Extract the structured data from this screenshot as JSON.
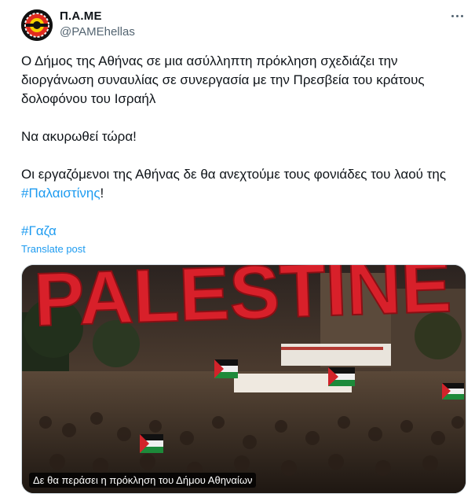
{
  "author": {
    "display_name": "Π.Α.ΜΕ",
    "handle": "@PAMEhellas"
  },
  "tweet": {
    "paragraph1": "Ο Δήμος της Αθήνας σε μια ασύλληπτη πρόκληση σχεδιάζει την διοργάνωση συναυλίας σε συνεργασία με την Πρεσβεία του κράτους δολοφόνου του Ισραήλ",
    "paragraph2": "Να ακυρωθεί τώρα!",
    "paragraph3_text": "Οι εργαζόμενοι της Αθήνας δε θα ανεχτούμε τους φονιάδες του λαού της ",
    "paragraph3_hashtag": "#Παλαιστίνης",
    "paragraph3_end": "!",
    "hashtag_gaza": "#Γαζα",
    "translate_label": "Translate post"
  },
  "media": {
    "banner_text": "PALESTINE",
    "caption": "Δε θα περάσει η πρόκληση του Δήμου Αθηναίων"
  },
  "icons": {
    "more": "more-horizontal-icon",
    "avatar": "pame-logo"
  },
  "colors": {
    "link": "#1d9bf0",
    "secondary_text": "#536471",
    "banner_red": "#d8202a"
  }
}
